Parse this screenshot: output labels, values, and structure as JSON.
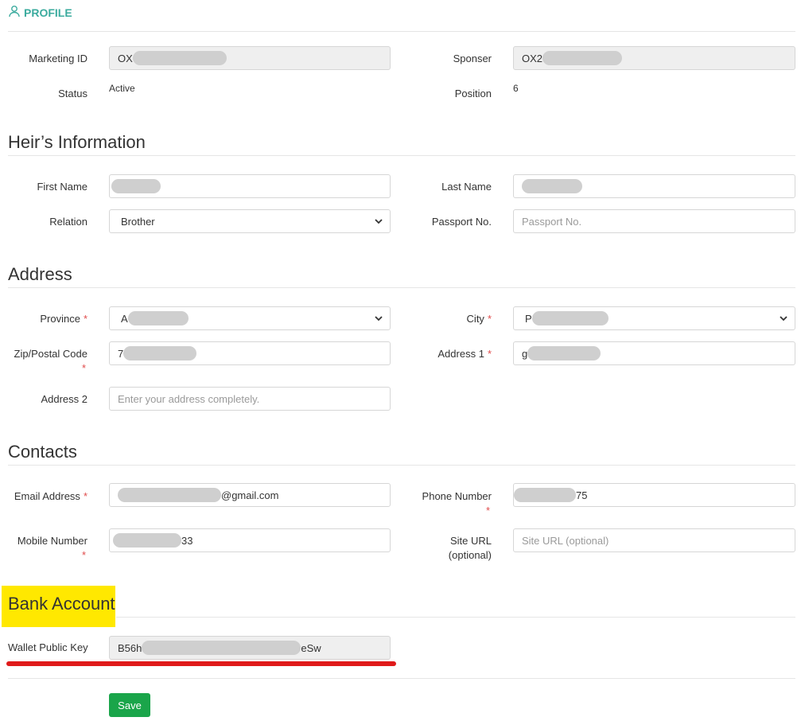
{
  "header": {
    "title": "PROFILE",
    "icon": "user-icon"
  },
  "profile": {
    "marketing_id_label": "Marketing ID",
    "marketing_id_value": "OX",
    "sponser_label": "Sponser",
    "sponser_value": "OX2",
    "status_label": "Status",
    "status_value": "Active",
    "position_label": "Position",
    "position_value": "6"
  },
  "heir": {
    "title": "Heir’s Information",
    "first_name_label": "First Name",
    "last_name_label": "Last Name",
    "relation_label": "Relation",
    "relation_value": "Brother",
    "passport_label": "Passport No.",
    "passport_placeholder": "Passport No."
  },
  "address": {
    "title": "Address",
    "province_label": "Province",
    "province_value": "A",
    "city_label": "City",
    "city_value": "P",
    "zip_label": "Zip/Postal Code",
    "zip_value": "7",
    "address1_label": "Address 1",
    "address1_value": "g",
    "address2_label": "Address 2",
    "address2_placeholder": "Enter your address completely."
  },
  "contacts": {
    "title": "Contacts",
    "email_label": "Email Address",
    "email_suffix": "@gmail.com",
    "phone_label": "Phone Number",
    "phone_suffix": "75",
    "mobile_label": "Mobile Number",
    "mobile_suffix": "33",
    "site_label_1": "Site URL",
    "site_label_2": "(optional)",
    "site_placeholder": "Site URL (optional)"
  },
  "bank": {
    "title": "Bank Account",
    "wallet_label": "Wallet Public Key",
    "wallet_prefix": "B56h",
    "wallet_suffix": "eSw"
  },
  "actions": {
    "save_label": "Save"
  },
  "required_mark": "*",
  "colors": {
    "accent": "#3bab9e",
    "save": "#1aa54a",
    "highlight": "#ffe800",
    "annotation": "#e01a1a",
    "required": "#e04b4b"
  }
}
